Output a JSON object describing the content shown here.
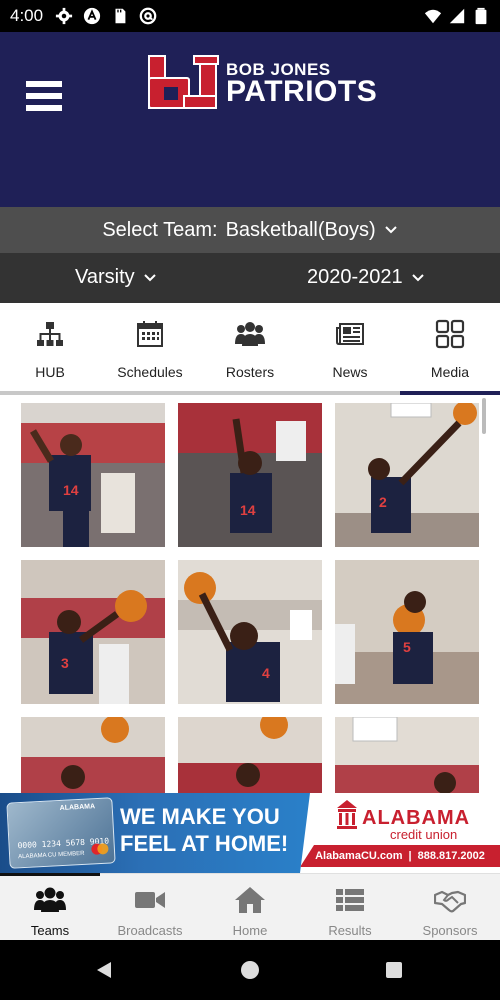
{
  "status_bar": {
    "time": "4:00",
    "left_icons": [
      "gear-icon",
      "app-a-icon",
      "sd-card-icon",
      "at-icon"
    ],
    "right_icons": [
      "wifi-icon",
      "signal-icon",
      "battery-icon"
    ]
  },
  "header": {
    "logo_mark": "bj",
    "logo_line1": "BOB JONES",
    "logo_line2": "PATRIOTS",
    "background": "#1f2057",
    "accent": "#c8202f"
  },
  "selectors": {
    "team_prefix": "Select Team:",
    "team_value": "Basketball(Boys)",
    "level": "Varsity",
    "season": "2020-2021"
  },
  "tabs": [
    {
      "label": "HUB",
      "icon": "sitemap-icon",
      "active": false
    },
    {
      "label": "Schedules",
      "icon": "calendar-icon",
      "active": false
    },
    {
      "label": "Rosters",
      "icon": "users-icon",
      "active": false
    },
    {
      "label": "News",
      "icon": "newspaper-icon",
      "active": false
    },
    {
      "label": "Media",
      "icon": "grid-icon",
      "active": true
    }
  ],
  "photos": [
    {
      "jersey": "14"
    },
    {
      "jersey": "14"
    },
    {
      "jersey": "2"
    },
    {
      "jersey": "3"
    },
    {
      "jersey": "4"
    },
    {
      "jersey": "5"
    },
    {
      "jersey": ""
    },
    {
      "jersey": ""
    },
    {
      "jersey": ""
    }
  ],
  "ad": {
    "card_logo": "ALABAMA",
    "card_number": "0000 1234 5678 9010",
    "card_name": "ALABAMA CU MEMBER",
    "slogan_line1": "WE MAKE YOU",
    "slogan_line2": "FEEL AT HOME!",
    "brand_name": "ALABAMA",
    "brand_sub": "credit union",
    "website": "AlabamaCU.com",
    "separator": "|",
    "phone": "888.817.2002"
  },
  "bottom_nav": [
    {
      "label": "Teams",
      "icon": "users-icon",
      "active": true
    },
    {
      "label": "Broadcasts",
      "icon": "video-camera-icon",
      "active": false
    },
    {
      "label": "Home",
      "icon": "home-icon",
      "active": false
    },
    {
      "label": "Results",
      "icon": "list-icon",
      "active": false
    },
    {
      "label": "Sponsors",
      "icon": "handshake-icon",
      "active": false
    }
  ]
}
